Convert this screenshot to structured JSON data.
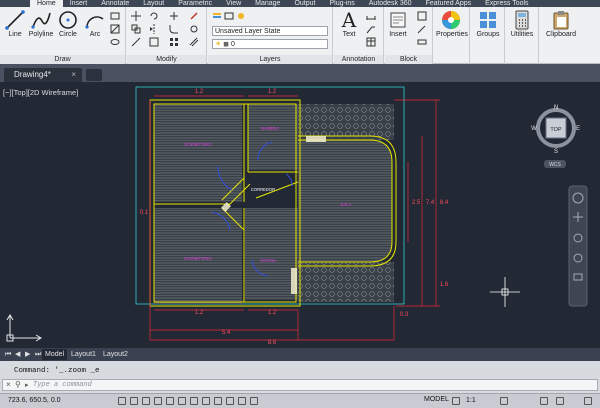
{
  "ribbon_tabs": [
    "Home",
    "Insert",
    "Annotate",
    "Layout",
    "Parametric",
    "View",
    "Manage",
    "Output",
    "Plug-ins",
    "Autodesk 360",
    "Featured Apps",
    "Express Tools"
  ],
  "active_tab": "Home",
  "draw_panel": {
    "title": "Draw",
    "tools": [
      "Line",
      "Polyline",
      "Circle",
      "Arc"
    ]
  },
  "modify_panel": {
    "title": "Modify"
  },
  "layers_panel": {
    "title": "Layers",
    "layer_state": "Unsaved Layer State",
    "current_layer": "0"
  },
  "annotation_panel": {
    "title": "Annotation",
    "text_tool": "Text"
  },
  "block_panel": {
    "title": "Block",
    "insert_tool": "Insert"
  },
  "properties_tool": "Properties",
  "groups_tool": "Groups",
  "utilities_tool": "Utilities",
  "clipboard_tool": "Clipboard",
  "document_tab": {
    "name": "Drawing4*",
    "close_glyph": "×"
  },
  "viewport_label": "[−][Top][2D Wireframe]",
  "viewcube": {
    "face": "TOP",
    "n": "N",
    "s": "S",
    "e": "E",
    "w": "W",
    "wcs": "WCS"
  },
  "drawing": {
    "top_dims": [
      "1.2",
      "1.2"
    ],
    "bottom_dims": [
      "1.2",
      "1.2"
    ],
    "overall_dims": [
      "5.4",
      "8.6"
    ],
    "right_dims": [
      "2.5",
      "7.4",
      "8.4",
      "1.6"
    ],
    "corner_dim": "0.3",
    "left_dim": "0.1",
    "room_labels": [
      "DORMITORIO",
      "BAÑERO",
      "CORREDOR",
      "SALA",
      "DORMITORIO",
      "COCINA"
    ],
    "colors": {
      "walls": "#e6e600",
      "dims": "#e8283c",
      "doors": "#2f4fe0",
      "hatch": "#8a8f96",
      "border": "#2fd0d0"
    }
  },
  "layout_tabs": [
    "Model",
    "Layout1",
    "Layout2"
  ],
  "active_layout": "Model",
  "command": {
    "history": "Command: '_.zoom _e",
    "prompt_icon": "▸",
    "placeholder": "Type a command"
  },
  "status_bar": {
    "coords": "723.6, 650.5, 0.0",
    "model": "MODEL",
    "scale": "1:1"
  }
}
